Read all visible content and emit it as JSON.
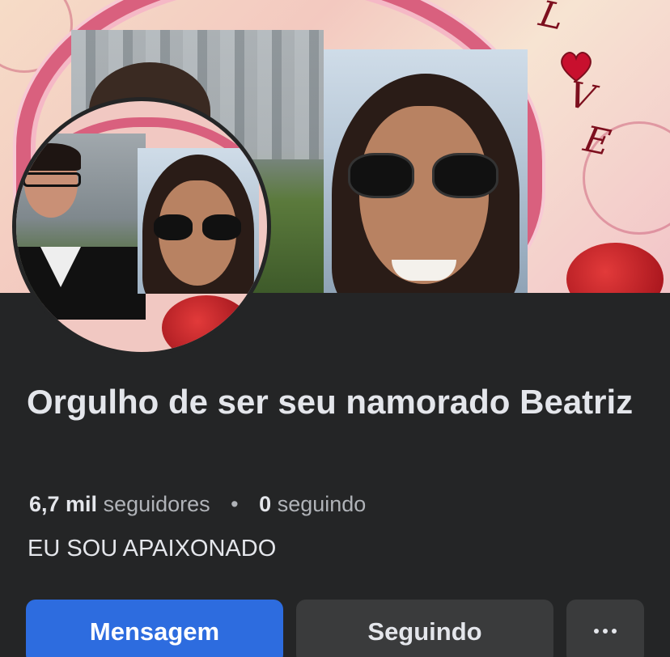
{
  "profile": {
    "name": "Orgulho de ser seu namorado Beatriz",
    "followers_count": "6,7 mil",
    "followers_label": "seguidores",
    "separator": "•",
    "following_count": "0",
    "following_label": "seguindo",
    "bio": "EU SOU APAIXONADO"
  },
  "cover": {
    "decor_text": [
      "L",
      "V",
      "E"
    ]
  },
  "actions": {
    "message_label": "Mensagem",
    "following_label": "Seguindo",
    "more_icon": "more-horizontal-icon"
  },
  "colors": {
    "background": "#242526",
    "primary_button": "#2d6cdf",
    "secondary_button": "#3a3b3c",
    "text_primary": "#e4e6eb",
    "text_secondary": "#b0b3b8"
  }
}
